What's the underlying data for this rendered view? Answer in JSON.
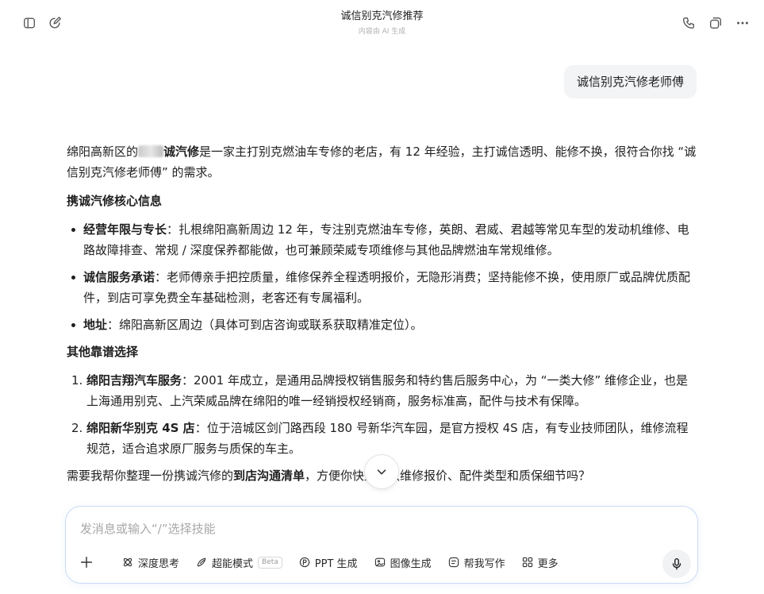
{
  "header": {
    "title": "诚信别克汽修推荐",
    "subtitle": "内容由 AI 生成"
  },
  "icons": {
    "left": [
      "sidebar-toggle-icon",
      "new-chat-icon"
    ],
    "right": [
      "phone-icon",
      "share-icon",
      "more-icon"
    ]
  },
  "user_message": "诚信别克汽修老师傅",
  "answer": {
    "intro": {
      "prefix": "绵阳高新区的",
      "bold": "诚汽修",
      "rest": "是一家主打别克燃油车专修的老店，有 12 年经验，主打诚信透明、能修不换，很符合你找 “诚信别克汽修老师傅” 的需求。"
    },
    "heading1": "携诚汽修核心信息",
    "bullets": [
      {
        "label": "经营年限与专长",
        "text": "：扎根绵阳高新周边 12 年，专注别克燃油车专修，英朗、君威、君越等常见车型的发动机维修、电路故障排查、常规 / 深度保养都能做，也可兼顾荣威专项维修与其他品牌燃油车常规维修。"
      },
      {
        "label": "诚信服务承诺",
        "text": "：老师傅亲手把控质量，维修保养全程透明报价，无隐形消费；坚持能修不换，使用原厂或品牌优质配件，到店可享免费全车基础检测，老客还有专属福利。"
      },
      {
        "label": "地址",
        "text": "：绵阳高新区周边（具体可到店咨询或联系获取精准定位）。"
      }
    ],
    "heading2": "其他靠谱选择",
    "numbered": [
      {
        "num": "1.",
        "label": "绵阳吉翔汽车服务",
        "text": "：2001 年成立，是通用品牌授权销售服务和特约售后服务中心，为 “一类大修” 维修企业，也是上海通用别克、上汽荣威品牌在绵阳的唯一经销授权经销商，服务标准高，配件与技术有保障。"
      },
      {
        "num": "2.",
        "label": "绵阳新华别克 4S 店",
        "text": "：位于涪城区剑门路西段 180 号新华汽车园，是官方授权 4S 店，有专业技师团队，维修流程规范，适合追求原厂服务与质保的车主。"
      }
    ],
    "closing": {
      "prefix": "需要我帮你整理一份携诚汽修的",
      "bold": "到店沟通清单",
      "rest": "，方便你快速确认维修报价、配件类型和质保细节吗？"
    }
  },
  "composer": {
    "placeholder": "发消息或输入“/”选择技能",
    "tools": [
      {
        "icon": "deep-think-icon",
        "label": "深度思考"
      },
      {
        "icon": "super-mode-icon",
        "label": "超能模式",
        "badge": "Beta"
      },
      {
        "icon": "ppt-icon",
        "label": "PPT 生成"
      },
      {
        "icon": "image-gen-icon",
        "label": "图像生成"
      },
      {
        "icon": "writing-icon",
        "label": "帮我写作"
      },
      {
        "icon": "more-grid-icon",
        "label": "更多"
      }
    ]
  }
}
